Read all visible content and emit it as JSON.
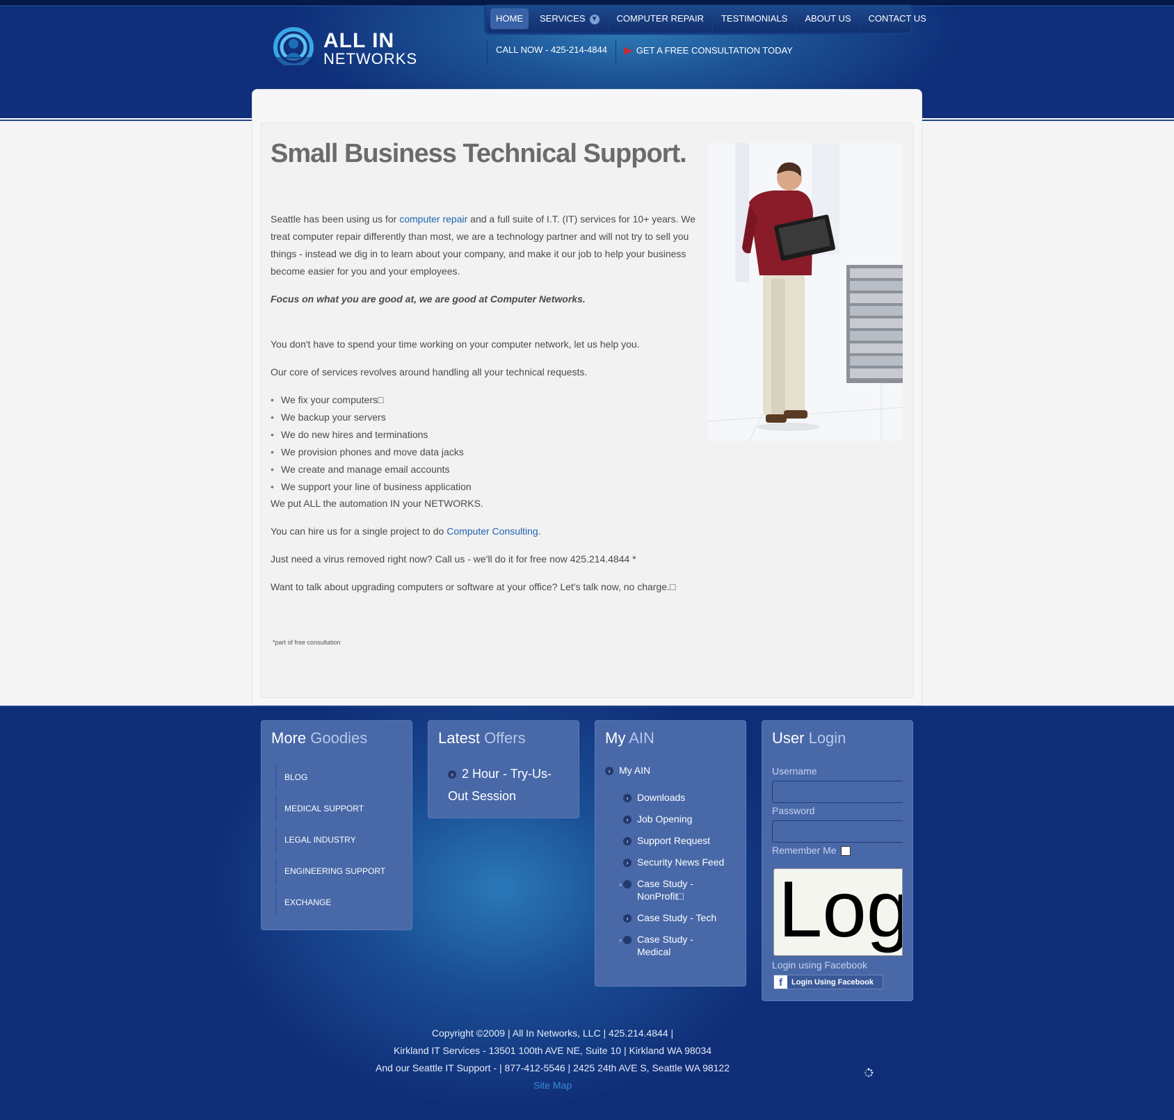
{
  "brand": {
    "logo_title": "ALL IN",
    "logo_subtitle": "NETWORKS",
    "primary_color": "#102e78",
    "accent_color": "#3a62a8",
    "link_color": "#1f63b0"
  },
  "nav": {
    "items": [
      {
        "label": "HOME",
        "active": true
      },
      {
        "label": "SERVICES",
        "dropdown": true
      },
      {
        "label": "COMPUTER REPAIR"
      },
      {
        "label": "TESTIMONIALS"
      },
      {
        "label": "ABOUT US"
      },
      {
        "label": "CONTACT US"
      }
    ],
    "call_now": "CALL NOW - 425-214-4844",
    "consultation": "GET A FREE CONSULTATION TODAY"
  },
  "main": {
    "headline": "Small Business Technical Support.",
    "p1_before": "Seattle has been using us for ",
    "p1_link": "computer repair",
    "p1_after": " and a full suite of I.T. (IT) services for 10+ years. We treat computer repair differently than most, we are a technology partner and will not try to sell you things - instead we dig in to learn about your company, and make it our job to help your business become easier for you and your employees.",
    "tagline": "Focus on what you are good at, we are good at Computer Networks.",
    "p2": "You don't have to spend your time working on your computer network, let us help you.",
    "p3": "Our core of services revolves around handling all your technical requests.",
    "services": [
      "We fix your computers□",
      "We backup your servers",
      "We do new hires and terminations",
      "We provision phones and move data jacks",
      "We create and manage email accounts",
      "We support your line of business application"
    ],
    "p4": "We put ALL the automation IN your NETWORKS.",
    "p5_before": "You can hire us for a single project to do ",
    "p5_link": "Computer Consulting",
    "p5_after": ".",
    "p6": "Just need a virus removed right now? Call us - we'll do it for free now 425.214.4844 *",
    "p7": "Want to talk about upgrading computers or software at your office? Let's talk now, no charge.□",
    "footnote": "*part of free consultation"
  },
  "goodies": {
    "title_a": "More",
    "title_b": "Goodies",
    "items": [
      "BLOG",
      "MEDICAL SUPPORT",
      "LEGAL INDUSTRY",
      "ENGINEERING SUPPORT",
      "EXCHANGE"
    ]
  },
  "offers": {
    "title_a": "Latest",
    "title_b": "Offers",
    "item": "2 Hour - Try-Us-Out Session"
  },
  "my_ain": {
    "title_a": "My",
    "title_b": "AIN",
    "root": "My AIN",
    "items": [
      "Downloads",
      "Job Opening",
      "Support Request",
      "Security News Feed",
      "Case Study - NonProfit□",
      "Case Study - Tech",
      "Case Study - Medical"
    ]
  },
  "login": {
    "title_a": "User",
    "title_b": "Login",
    "username_label": "Username",
    "password_label": "Password",
    "remember_label": "Remember Me",
    "button_label": "Log",
    "facebook_label": "Login using Facebook",
    "facebook_button": "Login Using Facebook"
  },
  "footer": {
    "line1": "Copyright ©2009 | All In Networks, LLC | 425.214.4844 |",
    "line2": "Kirkland IT Services - 13501 100th AVE NE, Suite 10 | Kirkland WA 98034",
    "line3": "And our Seattle IT Support -  | 877-412-5546 | 2425 24th AVE S, Seattle WA 98122",
    "sitemap": "Site Map"
  }
}
